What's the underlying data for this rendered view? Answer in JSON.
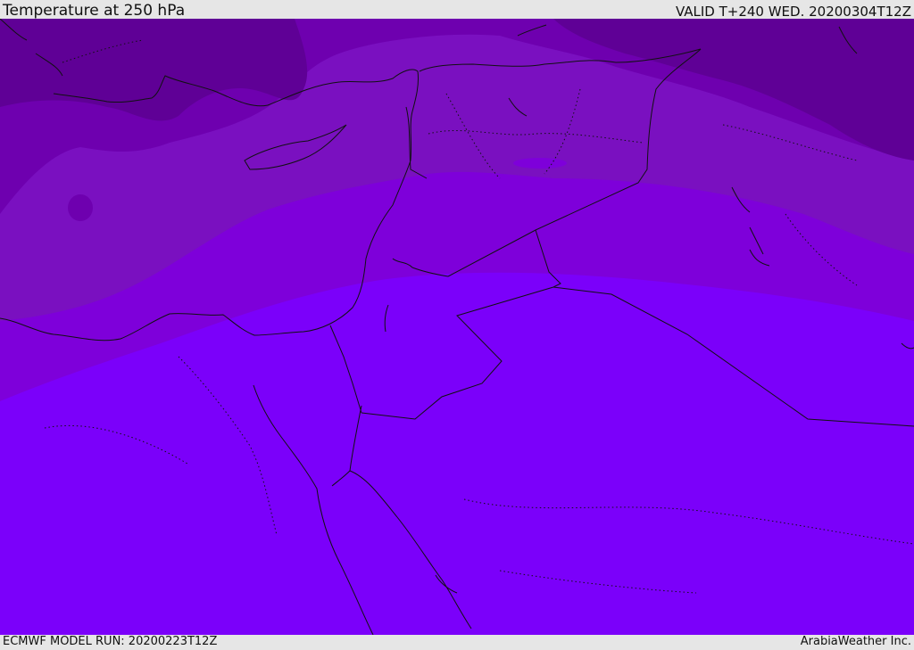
{
  "header": {
    "title": "Temperature at 250 hPa",
    "valid_time": "VALID T+240 WED. 20200304T12Z"
  },
  "footer": {
    "model_run": "ECMWF MODEL RUN: 20200223T12Z",
    "credit": "ArabiaWeather Inc."
  },
  "map": {
    "colors": {
      "coldest": "#5f0096",
      "cold": "#6e00af",
      "mid": "#7a10c0",
      "cool": "#7e00da",
      "warmest": "#7b00fa",
      "coast": "#111111"
    }
  }
}
